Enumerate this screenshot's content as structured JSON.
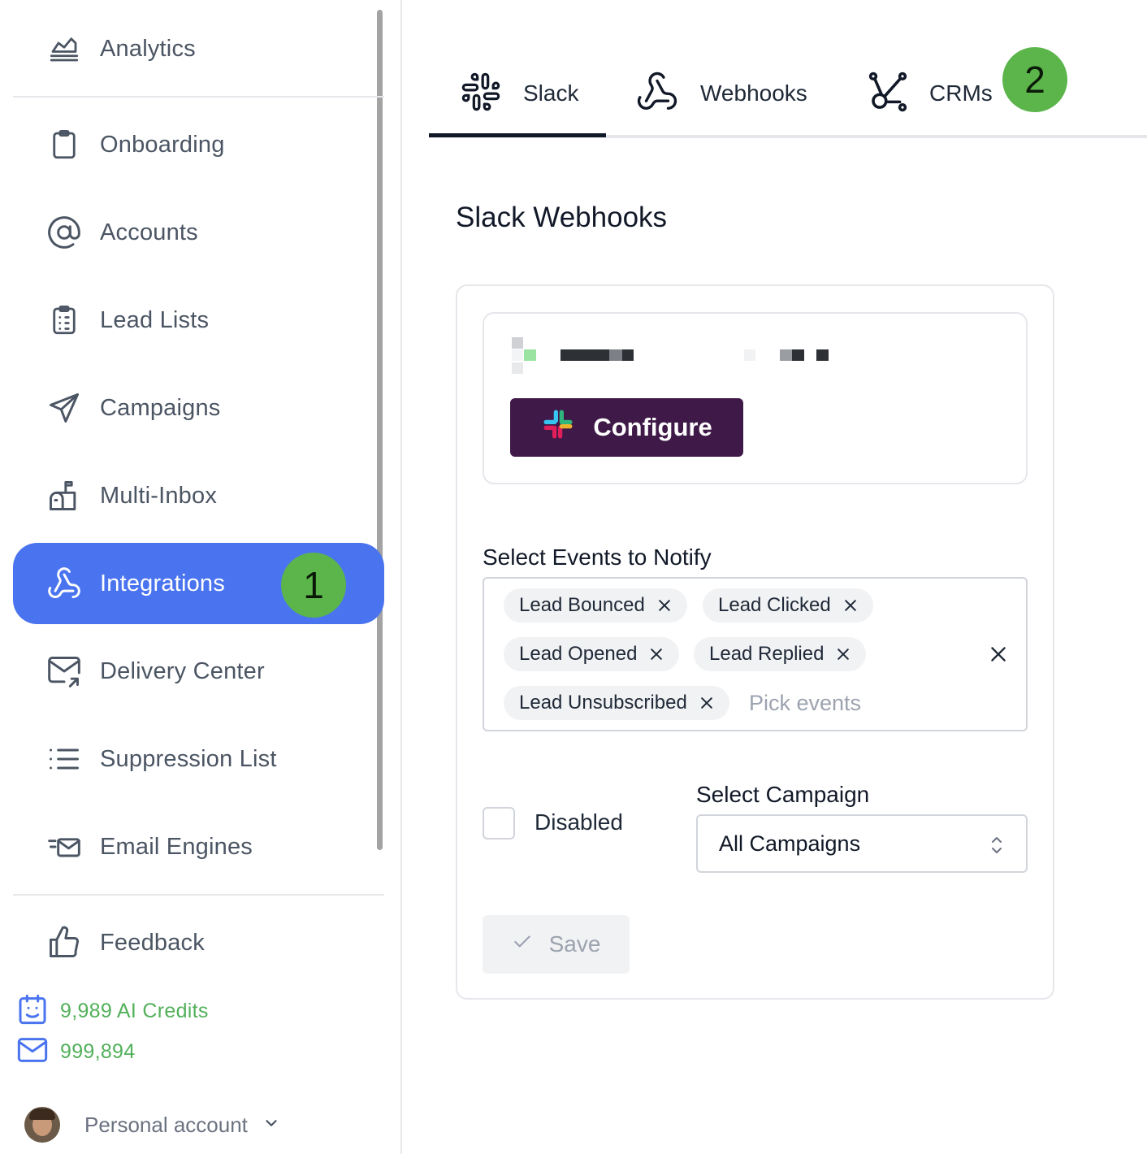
{
  "sidebar": {
    "items": [
      {
        "label": "Analytics",
        "icon": "analytics-icon"
      },
      {
        "label": "Onboarding",
        "icon": "clipboard-icon"
      },
      {
        "label": "Accounts",
        "icon": "at-sign-icon"
      },
      {
        "label": "Lead Lists",
        "icon": "list-clipboard-icon"
      },
      {
        "label": "Campaigns",
        "icon": "send-icon"
      },
      {
        "label": "Multi-Inbox",
        "icon": "mailbox-icon"
      },
      {
        "label": "Integrations",
        "icon": "webhook-icon",
        "active": true
      },
      {
        "label": "Delivery Center",
        "icon": "mail-arrow-icon"
      },
      {
        "label": "Suppression List",
        "icon": "list-icon"
      },
      {
        "label": "Email Engines",
        "icon": "fast-mail-icon"
      },
      {
        "label": "Feedback",
        "icon": "thumbs-up-icon"
      }
    ],
    "ai_credits": "9,989 AI Credits",
    "email_credits": "999,894",
    "account_label": "Personal account",
    "colors": {
      "active_bg": "#4a74ef",
      "credits_text": "#52b05a"
    }
  },
  "annotations": {
    "badge_1": "1",
    "badge_2": "2",
    "badge_color": "#5bb54a"
  },
  "tabs": [
    {
      "label": "Slack",
      "icon": "slack-icon",
      "active": true
    },
    {
      "label": "Webhooks",
      "icon": "webhook-icon"
    },
    {
      "label": "CRMs",
      "icon": "crm-nodes-icon"
    }
  ],
  "main": {
    "title": "Slack Webhooks",
    "configure_label": "Configure",
    "configure_color": "#3f1948",
    "events_label": "Select Events to Notify",
    "events": [
      "Lead Bounced",
      "Lead Clicked",
      "Lead Opened",
      "Lead Replied",
      "Lead Unsubscribed"
    ],
    "events_placeholder": "Pick events",
    "disabled_label": "Disabled",
    "disabled_checked": false,
    "campaign_label": "Select Campaign",
    "campaign_value": "All Campaigns",
    "save_label": "Save"
  }
}
